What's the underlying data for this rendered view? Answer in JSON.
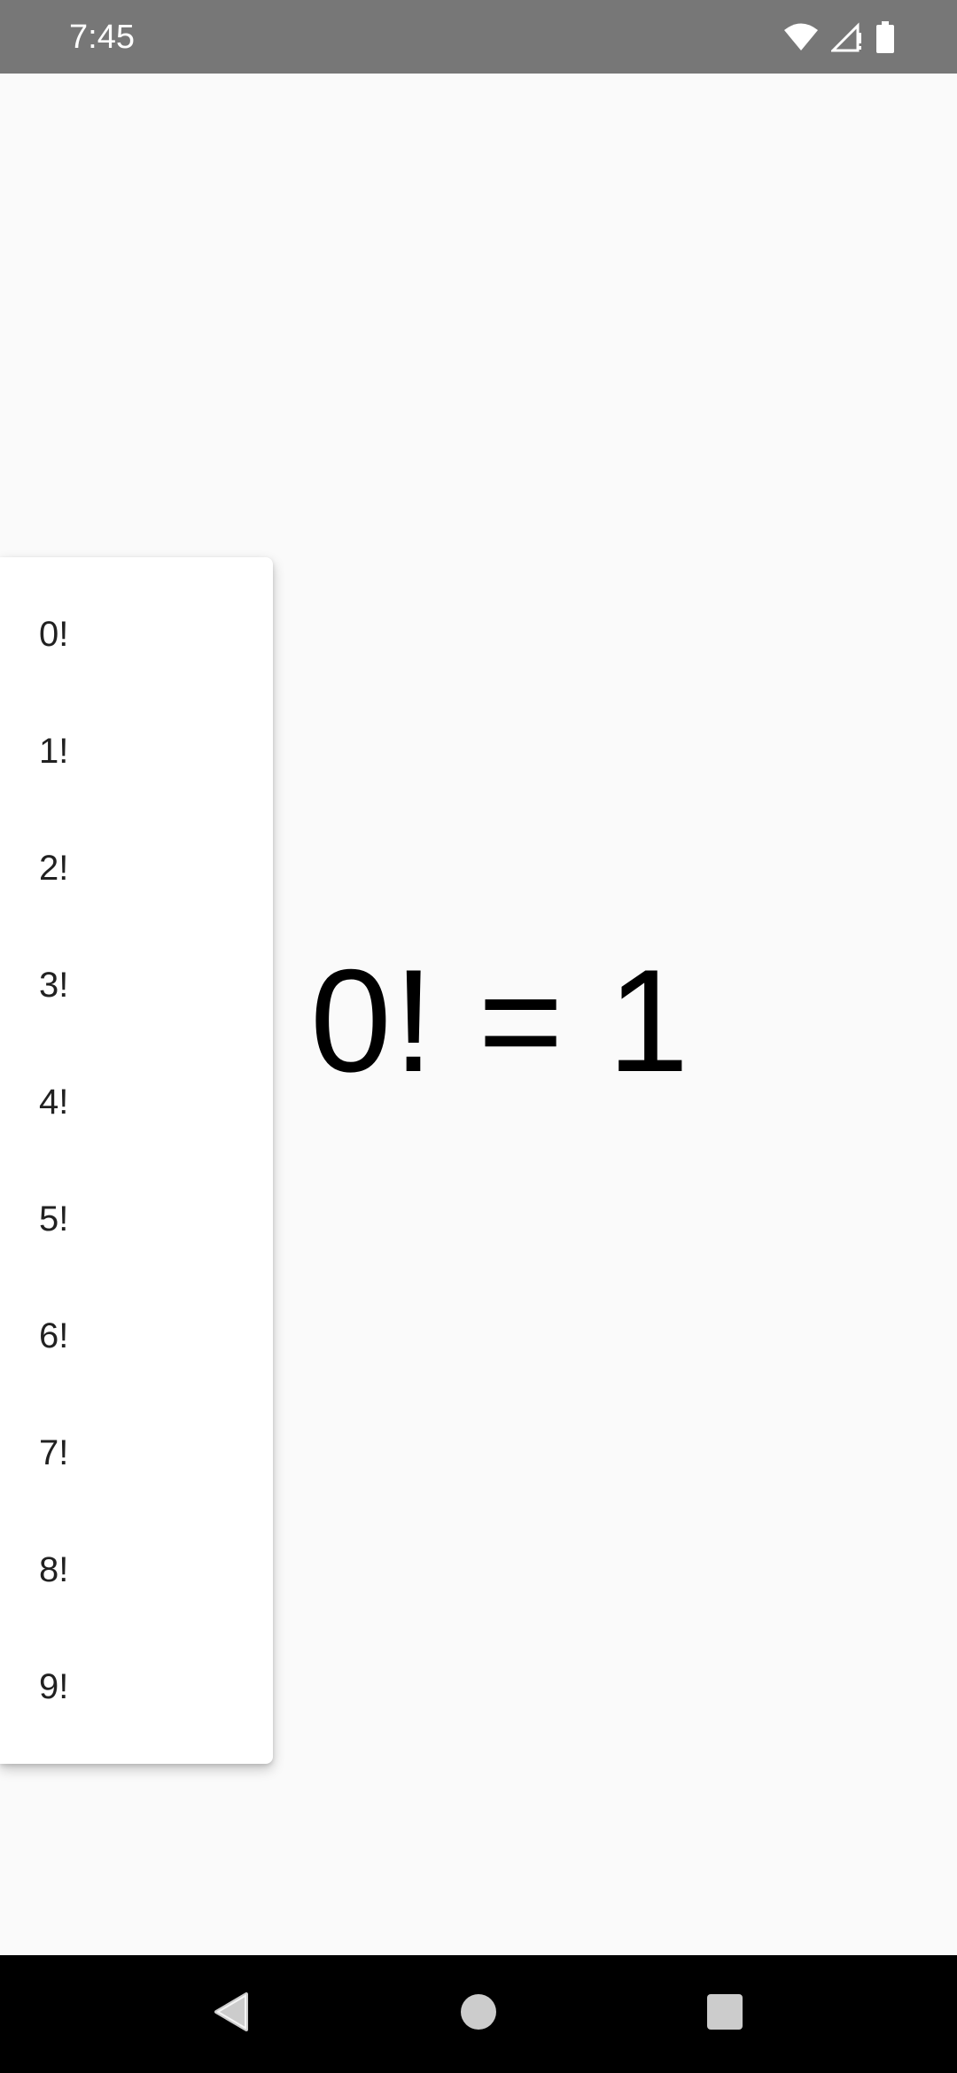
{
  "status_bar": {
    "time": "7:45",
    "icons": [
      "wifi-icon",
      "signal-icon",
      "battery-icon"
    ]
  },
  "result": {
    "text": "0! = 1"
  },
  "menu": {
    "items": [
      {
        "label": "0!"
      },
      {
        "label": "1!"
      },
      {
        "label": "2!"
      },
      {
        "label": "3!"
      },
      {
        "label": "4!"
      },
      {
        "label": "5!"
      },
      {
        "label": "6!"
      },
      {
        "label": "7!"
      },
      {
        "label": "8!"
      },
      {
        "label": "9!"
      }
    ]
  },
  "nav_bar": {
    "buttons": [
      "back-icon",
      "home-icon",
      "recents-icon"
    ]
  },
  "colors": {
    "status_bar_bg": "#777777",
    "background": "#fafafa",
    "menu_bg": "#ffffff",
    "nav_bar_bg": "#000000"
  }
}
